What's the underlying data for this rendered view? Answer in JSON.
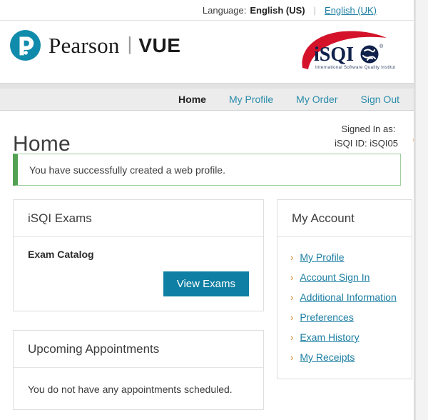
{
  "language_bar": {
    "label": "Language:",
    "current": "English (US)",
    "separator": "|",
    "alternate": "English (UK)"
  },
  "header": {
    "pearson_word": "Pearson",
    "pearson_divider": "|",
    "pearson_vue": "VUE",
    "isqi_text": "iSQI",
    "isqi_tagline": "International Software Quality Institute",
    "isqi_registered": "®"
  },
  "nav": {
    "items": [
      {
        "label": "Home",
        "active": true
      },
      {
        "label": "My Profile",
        "active": false
      },
      {
        "label": "My Order",
        "active": false
      },
      {
        "label": "Sign Out",
        "active": false
      }
    ]
  },
  "title": {
    "page_title": "Home",
    "signed_in_label": "Signed In as:",
    "signed_in_value": "",
    "isqi_id_label": "iSQI ID:",
    "isqi_id_value": "iSQI05",
    "redaction_color": "#F5821F"
  },
  "alert": {
    "message": "You have successfully created a web profile.",
    "accent_color": "#53a153",
    "border_color": "#9fcf9f"
  },
  "exams_card": {
    "header": "iSQI Exams",
    "catalog_label": "Exam Catalog",
    "button_label": "View Exams",
    "button_color": "#0f7fa3"
  },
  "appointments_card": {
    "header": "Upcoming Appointments",
    "empty_message": "You do not have any appointments scheduled."
  },
  "account_card": {
    "header": "My Account",
    "links": [
      {
        "label": "My Profile"
      },
      {
        "label": "Account Sign In"
      },
      {
        "label": "Additional Information"
      },
      {
        "label": "Preferences"
      },
      {
        "label": "Exam History"
      },
      {
        "label": "My Receipts"
      }
    ],
    "chevron": "›",
    "chevron_color": "#d2832a",
    "link_color": "#1d7fa3"
  }
}
